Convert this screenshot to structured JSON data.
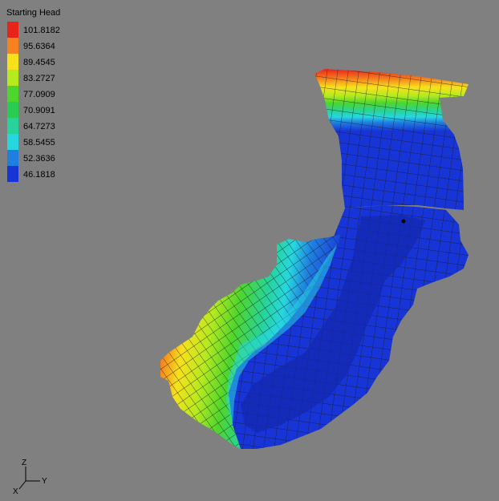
{
  "legend": {
    "title": "Starting Head",
    "entries": [
      {
        "label": "101.8182",
        "color": "#e8231a"
      },
      {
        "label": "95.6364",
        "color": "#f5821f"
      },
      {
        "label": "89.4545",
        "color": "#f7e11b"
      },
      {
        "label": "83.2727",
        "color": "#b5ea1f"
      },
      {
        "label": "77.0909",
        "color": "#4fd62d"
      },
      {
        "label": "70.9091",
        "color": "#29cc52"
      },
      {
        "label": "64.7273",
        "color": "#27d39a"
      },
      {
        "label": "58.5455",
        "color": "#27d7e0"
      },
      {
        "label": "52.3636",
        "color": "#1f7ee0"
      },
      {
        "label": "46.1818",
        "color": "#1734d6"
      }
    ]
  },
  "triad": {
    "z_label": "Z",
    "y_label": "Y",
    "x_label": "X"
  },
  "colors": {
    "background": "#808080",
    "mesh_line": "#1a1a1a"
  }
}
